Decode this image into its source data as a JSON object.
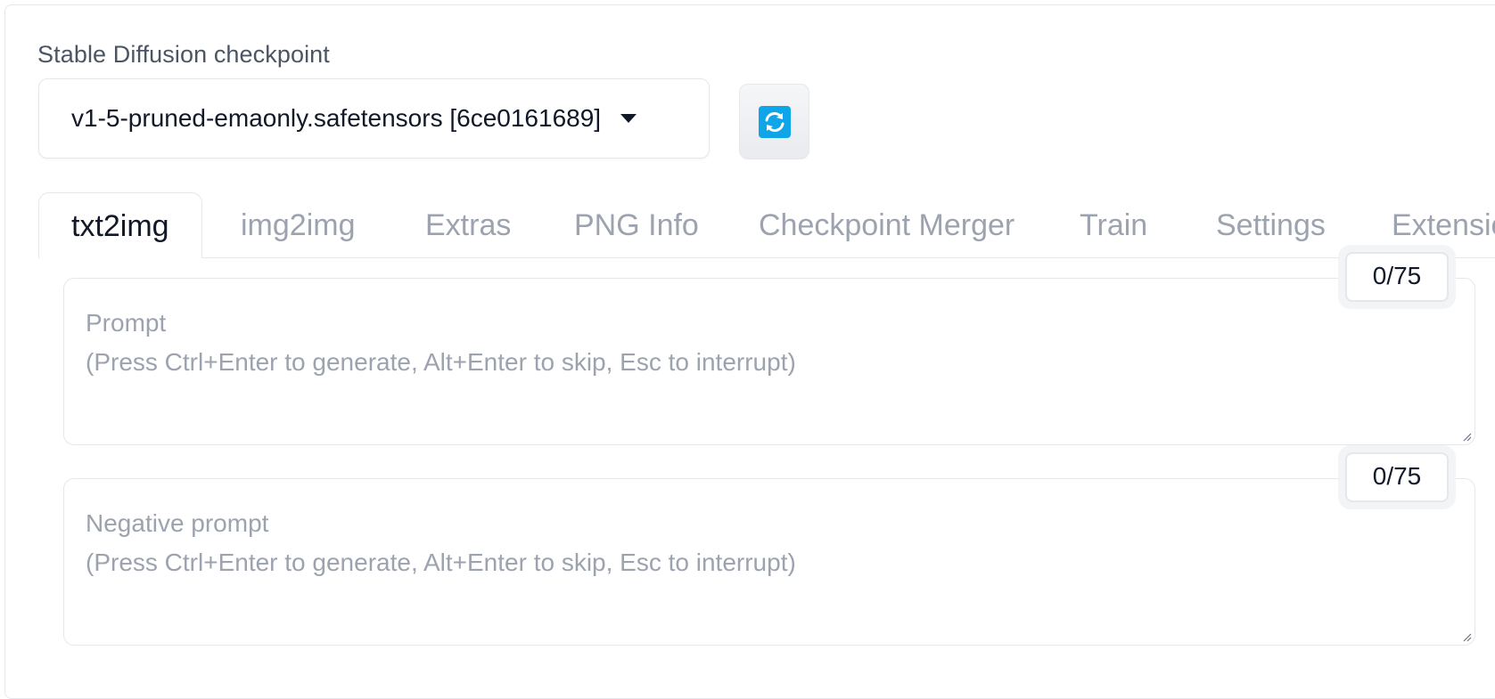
{
  "checkpoint": {
    "label": "Stable Diffusion checkpoint",
    "selected": "v1-5-pruned-emaonly.safetensors [6ce0161689]"
  },
  "colors": {
    "accent": "#0ea5e9",
    "text_primary": "#111827",
    "text_muted": "#9ca3af",
    "border": "#e5e7eb"
  },
  "tabs": [
    {
      "label": "txt2img",
      "active": true
    },
    {
      "label": "img2img",
      "active": false
    },
    {
      "label": "Extras",
      "active": false
    },
    {
      "label": "PNG Info",
      "active": false
    },
    {
      "label": "Checkpoint Merger",
      "active": false
    },
    {
      "label": "Train",
      "active": false
    },
    {
      "label": "Settings",
      "active": false
    },
    {
      "label": "Extensions",
      "active": false
    }
  ],
  "prompt": {
    "placeholder": "Prompt\n(Press Ctrl+Enter to generate, Alt+Enter to skip, Esc to interrupt)",
    "token_count": "0/75"
  },
  "negative_prompt": {
    "placeholder": "Negative prompt\n(Press Ctrl+Enter to generate, Alt+Enter to skip, Esc to interrupt)",
    "token_count": "0/75"
  }
}
